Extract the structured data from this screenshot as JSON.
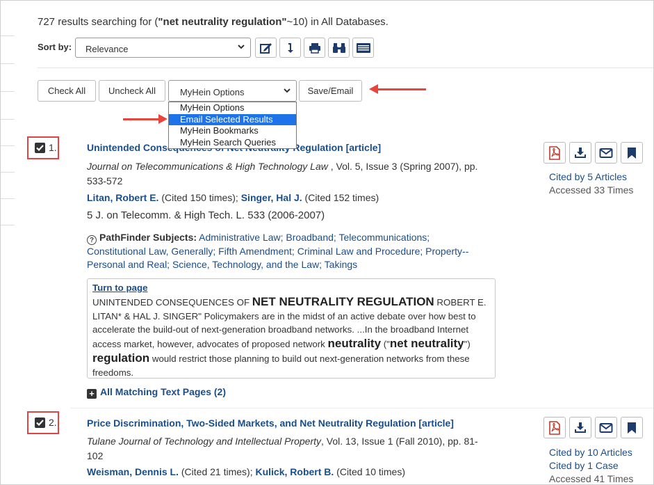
{
  "summary": {
    "count": "727",
    "text1": " results searching for (",
    "query": "\"net neutrality regulation\"",
    "text2": "~10) in All Databases."
  },
  "sort": {
    "label": "Sort by:",
    "value": "Relevance"
  },
  "toolbar_icons": [
    "edit-icon",
    "sort-download-icon",
    "print-icon",
    "binoculars-icon",
    "list-view-icon"
  ],
  "actions": {
    "check_all": "Check All",
    "uncheck_all": "Uncheck All",
    "myhein_select": "MyHein Options",
    "save_email": "Save/Email"
  },
  "dropdown": {
    "options": [
      "MyHein Options",
      "Email Selected Results",
      "MyHein Bookmarks",
      "MyHein Search Queries"
    ],
    "selected": "Email Selected Results"
  },
  "results": [
    {
      "num": "1.",
      "title": "Unintended Consequences of Net Neutrality Regulation [article]",
      "journal": "Journal on Telecommunications & High Technology Law",
      "details": " , Vol. 5, Issue 3 (Spring 2007), pp. 533-572",
      "authors": [
        {
          "name": "Litan, Robert E.",
          "cited": " (Cited 150 times); "
        },
        {
          "name": "Singer, Hal J.",
          "cited": " (Cited 152 times)"
        }
      ],
      "citation": "5 J. on Telecomm. & High Tech. L. 533 (2006-2007)",
      "pathfinder_label": "PathFinder Subjects:",
      "pathfinder_subjects": " Administrative Law; Broadband; Telecommunications; Constitutional Law, Generally; Fifth Amendment; Criminal Law and Procedure; Property--Personal and Real; Science, Technology, and the Law; Takings",
      "snippet": {
        "turn": "Turn to page",
        "t1": "UNINTENDED CONSEQUENCES OF ",
        "h1": "NET NEUTRALITY REGULATION",
        "t2": " ROBERT E. LITAN* & HAL J. SINGER\" Policymakers are in the midst of an active debate over how best to accelerate the build-out of next-generation broadband networks. ...In the broadband Internet access market, however, advocates of proposed network ",
        "h2": "neutrality",
        "t3": " (\"",
        "h3": "net neutrality",
        "t4": "\") ",
        "h4": "regulation",
        "t5": " would restrict those planning to build out next-generation networks from these freedoms."
      },
      "matching": "All Matching Text Pages (2)",
      "stats": {
        "cited_by": "Cited by 5 Articles",
        "accessed": "Accessed 33 Times"
      }
    },
    {
      "num": "2.",
      "title": "Price Discrimination, Two-Sided Markets, and Net Neutrality Regulation [article]",
      "journal": "Tulane Journal of Technology and Intellectual Property",
      "details": ", Vol. 13, Issue 1 (Fall 2010), pp. 81-102",
      "authors": [
        {
          "name": "Weisman, Dennis L.",
          "cited": " (Cited 21 times); "
        },
        {
          "name": "Kulick, Robert B.",
          "cited": " (Cited 10 times)"
        }
      ],
      "stats": {
        "cited_by": "Cited by 10 Articles",
        "cited_case": "Cited by 1 Case",
        "accessed": "Accessed 41 Times"
      }
    }
  ],
  "colors": {
    "link": "#1a4e8a",
    "annotation": "#e04545",
    "icon": "#1d3c6b",
    "pdf": "#c0392b",
    "highlight": "#1e73e8"
  }
}
